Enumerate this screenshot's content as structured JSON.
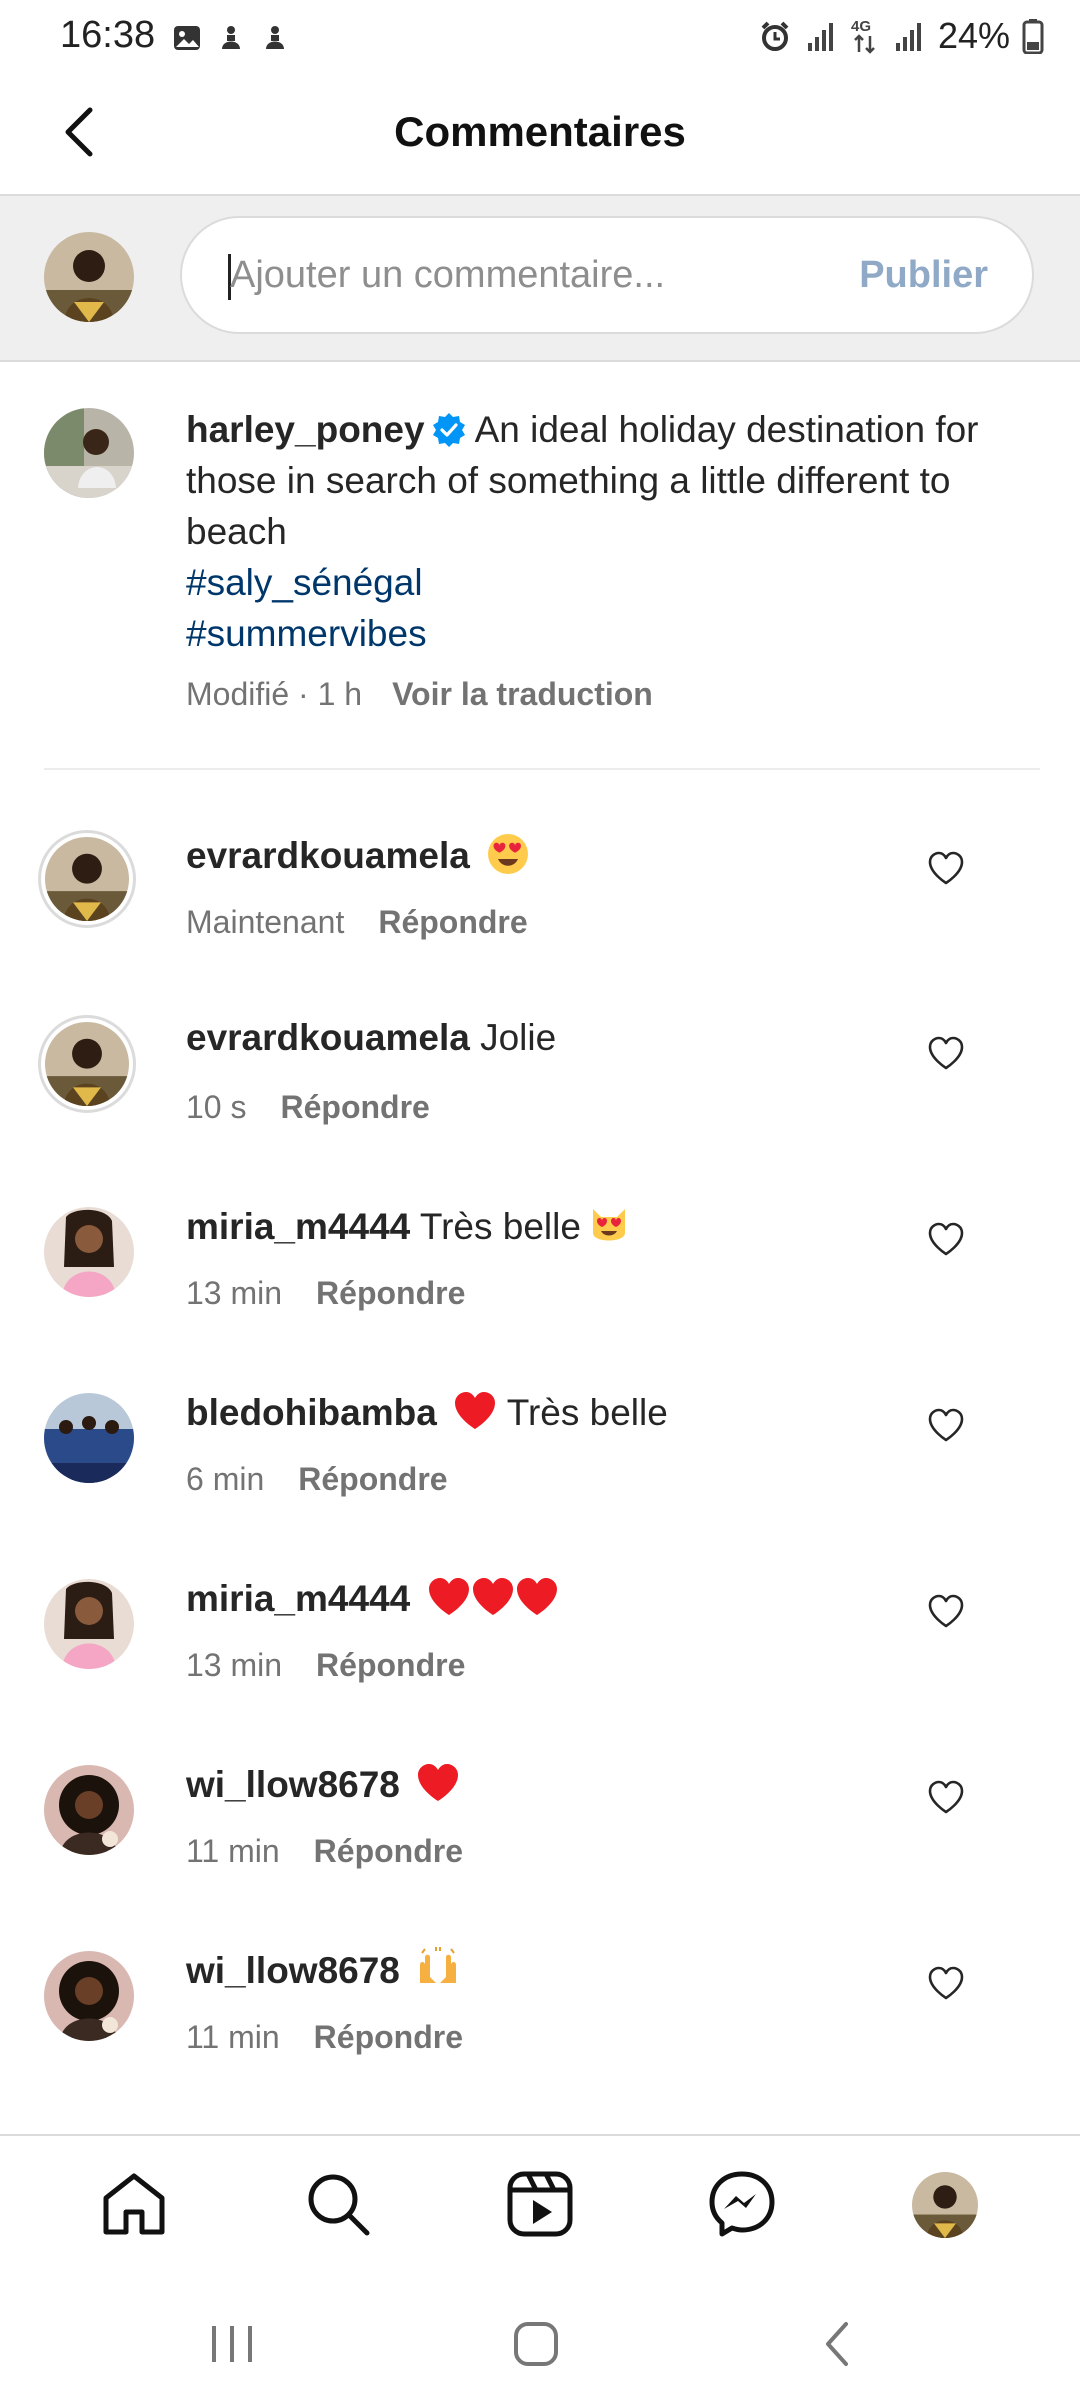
{
  "status": {
    "time": "16:38",
    "battery": "24%",
    "network": "4G"
  },
  "header": {
    "title": "Commentaires"
  },
  "composer": {
    "placeholder": "Ajouter un commentaire...",
    "publish_label": "Publier"
  },
  "caption": {
    "username": "harley_poney",
    "text": "An ideal holiday destination for those in search of something a little different to beach",
    "hashtags": [
      "#saly_sénégal",
      "#summervibes"
    ],
    "meta": "Modifié · 1 h",
    "translate": "Voir la traduction"
  },
  "comments": [
    {
      "username": "evrardkouamela",
      "text": "",
      "time": "Maintenant",
      "reply": "Répondre",
      "emoji": "heart-eyes-emoji"
    },
    {
      "username": "evrardkouamela",
      "text": "Jolie",
      "time": "10 s",
      "reply": "Répondre"
    },
    {
      "username": "miria_m4444",
      "text": "Très belle",
      "time": "13 min",
      "reply": "Répondre",
      "emoji": "heart-eyes-cat-emoji"
    },
    {
      "username": "bledohibamba",
      "text": "Très belle",
      "time": "6 min",
      "reply": "Répondre",
      "emoji": "red-heart-emoji"
    },
    {
      "username": "miria_m4444",
      "text": "",
      "time": "13 min",
      "reply": "Répondre",
      "emoji": "three-red-hearts-emoji"
    },
    {
      "username": "wi_llow8678",
      "text": "",
      "time": "11 min",
      "reply": "Répondre",
      "emoji": "red-heart-emoji"
    },
    {
      "username": "wi_llow8678",
      "text": "",
      "time": "11 min",
      "reply": "Répondre",
      "emoji": "raising-hands-emoji"
    }
  ],
  "bottom_nav": [
    "home-icon",
    "search-icon",
    "reels-icon",
    "messenger-icon",
    "profile-avatar"
  ],
  "colors": {
    "hashtag": "#00376b",
    "verified": "#0095f6",
    "publish_disabled": "#8fa9c6",
    "heart": "#ed1c24"
  }
}
